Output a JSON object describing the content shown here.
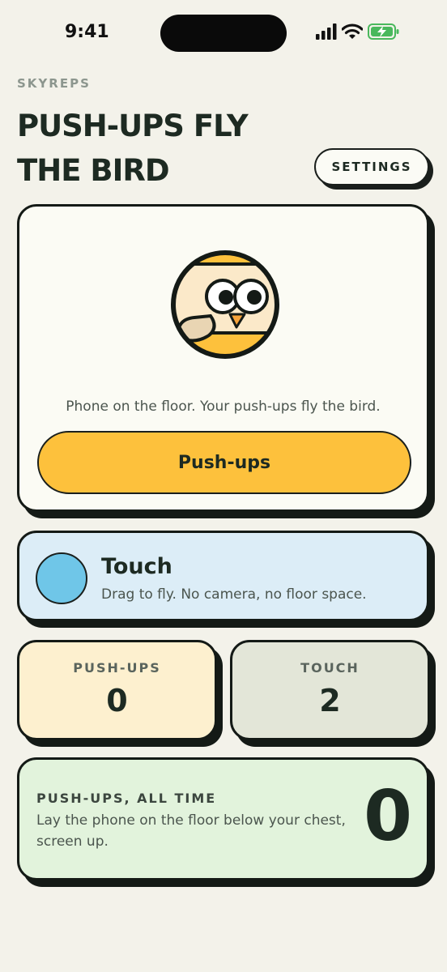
{
  "status_bar": {
    "time": "9:41"
  },
  "header": {
    "brand": "SKYREPS",
    "title_line1": "PUSH-UPS FLY",
    "title_line2": "THE BIRD",
    "settings_label": "SETTINGS"
  },
  "main_card": {
    "description": "Phone on the floor. Your push-ups fly the bird.",
    "button_label": "Push-ups"
  },
  "touch_card": {
    "title": "Touch",
    "description": "Drag to fly. No camera, no floor space."
  },
  "stats": [
    {
      "label": "PUSH-UPS",
      "value": "0"
    },
    {
      "label": "TOUCH",
      "value": "2"
    }
  ],
  "all_time": {
    "label": "PUSH-UPS, ALL TIME",
    "description": "Lay the phone on the floor below your chest, screen up.",
    "value": "0"
  },
  "colors": {
    "background": "#f3f2ea",
    "accent_yellow": "#fdc13c",
    "touch_blue": "#6fc6e8",
    "ink": "#1d2a22"
  },
  "icons": [
    "signal-icon",
    "wifi-icon",
    "battery-charging-icon",
    "bird-icon"
  ]
}
